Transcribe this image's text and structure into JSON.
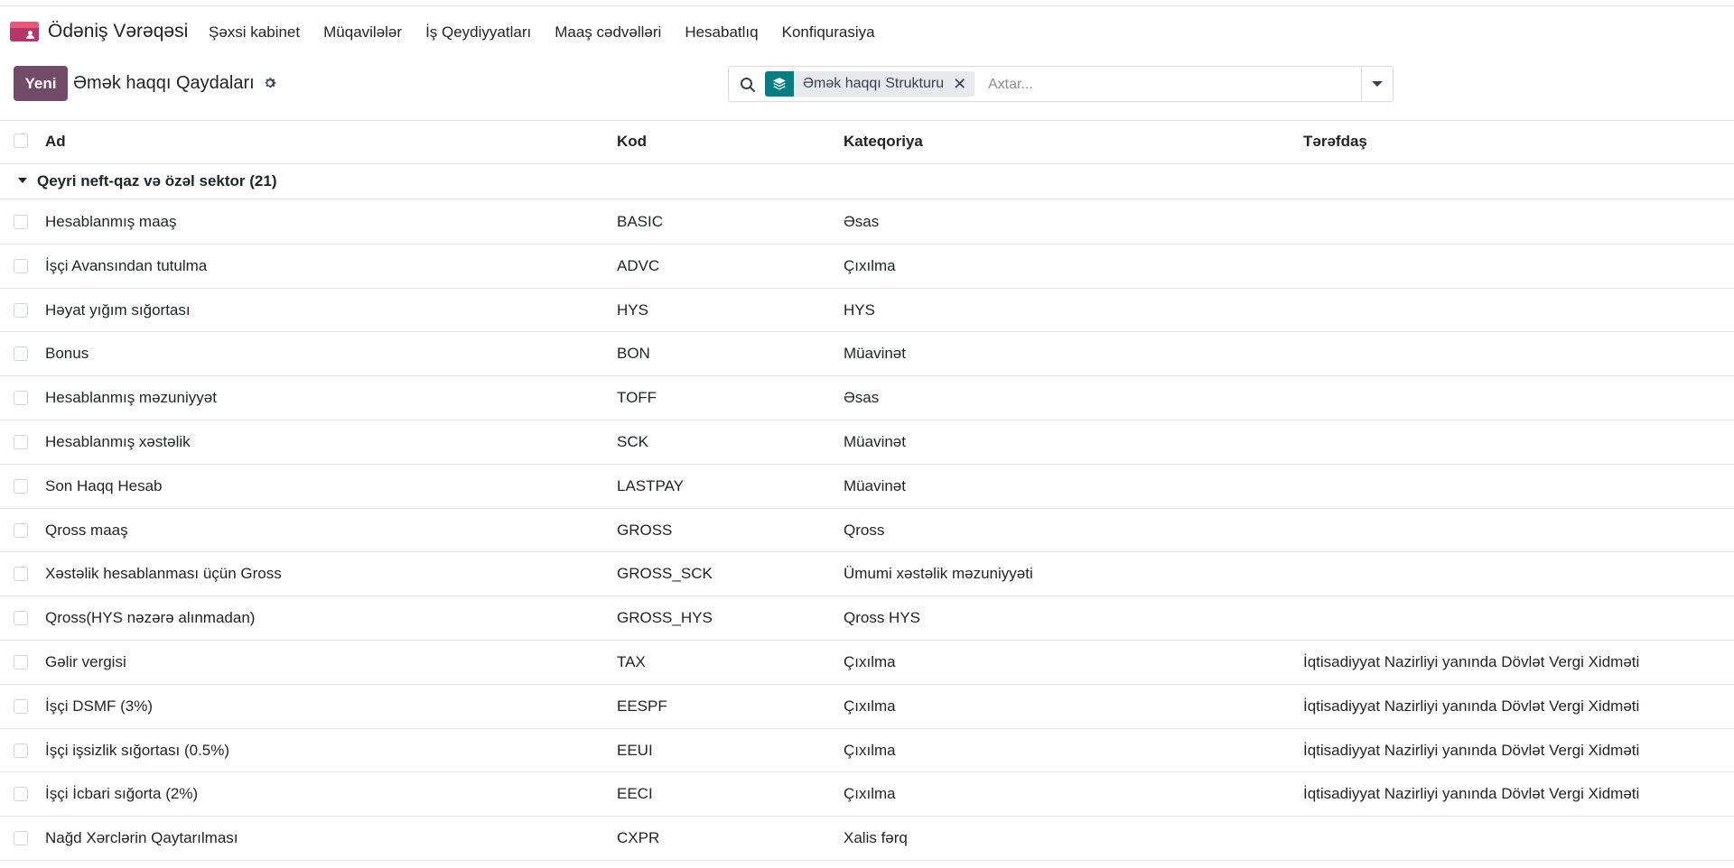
{
  "app": {
    "name": "Ödəniş Vərəqəsi",
    "menu": [
      "Şəxsi kabinet",
      "Müqavilələr",
      "İş Qeydiyyatları",
      "Maaş cədvəlləri",
      "Hesabatlıq",
      "Konfiqurasiya"
    ]
  },
  "control_panel": {
    "new_button": "Yeni",
    "breadcrumb": "Əmək haqqı Qaydaları",
    "search": {
      "facet_label": "Əmək haqqı Strukturu",
      "placeholder": "Axtar..."
    }
  },
  "table": {
    "columns": [
      "Ad",
      "Kod",
      "Kateqoriya",
      "Tərəfdaş"
    ],
    "group": {
      "label": "Qeyri neft-qaz və özəl sektor (21)",
      "expanded": true
    },
    "rows": [
      {
        "name": "Hesablanmış maaş",
        "code": "BASIC",
        "category": "Əsas",
        "partner": ""
      },
      {
        "name": "İşçi Avansından tutulma",
        "code": "ADVC",
        "category": "Çıxılma",
        "partner": ""
      },
      {
        "name": "Həyat yığım sığortası",
        "code": "HYS",
        "category": "HYS",
        "partner": ""
      },
      {
        "name": "Bonus",
        "code": "BON",
        "category": "Müavinət",
        "partner": ""
      },
      {
        "name": "Hesablanmış məzuniyyət",
        "code": "TOFF",
        "category": "Əsas",
        "partner": ""
      },
      {
        "name": "Hesablanmış xəstəlik",
        "code": "SCK",
        "category": "Müavinət",
        "partner": ""
      },
      {
        "name": "Son Haqq Hesab",
        "code": "LASTPAY",
        "category": "Müavinət",
        "partner": ""
      },
      {
        "name": "Qross maaş",
        "code": "GROSS",
        "category": "Qross",
        "partner": ""
      },
      {
        "name": "Xəstəlik hesablanması üçün Gross",
        "code": "GROSS_SCK",
        "category": "Ümumi xəstəlik məzuniyyəti",
        "partner": ""
      },
      {
        "name": "Qross(HYS nəzərə alınmadan)",
        "code": "GROSS_HYS",
        "category": "Qross HYS",
        "partner": ""
      },
      {
        "name": "Gəlir vergisi",
        "code": "TAX",
        "category": "Çıxılma",
        "partner": "İqtisadiyyat Nazirliyi yanında Dövlət Vergi Xidməti"
      },
      {
        "name": "İşçi DSMF (3%)",
        "code": "EESPF",
        "category": "Çıxılma",
        "partner": "İqtisadiyyat Nazirliyi yanında Dövlət Vergi Xidməti"
      },
      {
        "name": "İşçi işsizlik sığortası (0.5%)",
        "code": "EEUI",
        "category": "Çıxılma",
        "partner": "İqtisadiyyat Nazirliyi yanında Dövlət Vergi Xidməti"
      },
      {
        "name": "İşçi İcbari sığorta (2%)",
        "code": "EECI",
        "category": "Çıxılma",
        "partner": "İqtisadiyyat Nazirliyi yanında Dövlət Vergi Xidməti"
      },
      {
        "name": "Nağd Xərclərin Qaytarılması",
        "code": "CXPR",
        "category": "Xalis fərq",
        "partner": ""
      }
    ]
  },
  "colors": {
    "brand": "#714b67",
    "facet_accent": "#017e84",
    "app_icon": "#c23a6e",
    "border": "#e3e5e8"
  },
  "icons": {
    "app": "payroll-app-icon",
    "settings": "gear-icon",
    "search": "search-icon",
    "facet": "layers-icon",
    "facet_remove": "close-icon",
    "toggle": "caret-down-icon",
    "group_toggle": "caret-down-icon"
  }
}
